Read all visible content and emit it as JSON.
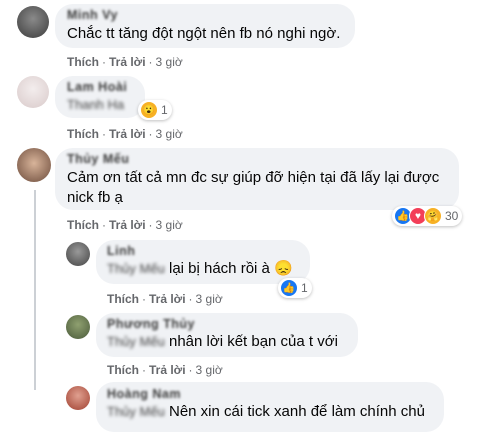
{
  "comments": [
    {
      "name": "Minh Vy",
      "text": "Chắc tt tăng đột ngột nên fb nó nghi ngờ.",
      "actions": {
        "like": "Thích",
        "reply": "Trả lời",
        "time": "3 giờ"
      }
    },
    {
      "name": "Lam Hoài",
      "text_prefix": "Thanh Ha",
      "text": "",
      "reaction": {
        "icons": [
          "wow-icon"
        ],
        "count": "1"
      },
      "actions": {
        "like": "Thích",
        "reply": "Trả lời",
        "time": "3 giờ"
      }
    },
    {
      "name": "Thủy Mếu",
      "text": "Cảm ơn tất cả mn đc sự giúp đỡ hiện tại đã lấy lại được nick fb ạ",
      "reaction": {
        "icons": [
          "like-icon",
          "love-icon",
          "care-icon"
        ],
        "count": "30"
      },
      "actions": {
        "like": "Thích",
        "reply": "Trả lời",
        "time": "3 giờ"
      }
    }
  ],
  "replies": [
    {
      "name": "Linh",
      "text_prefix": "Thủy Mếu",
      "text": "lại bị hách rồi à 😞",
      "reaction": {
        "icons": [
          "like-icon"
        ],
        "count": "1"
      },
      "actions": {
        "like": "Thích",
        "reply": "Trả lời",
        "time": "3 giờ"
      }
    },
    {
      "name": "Phương Thủy",
      "text_prefix": "Thủy Mếu",
      "text": "nhân lời kết bạn của t với",
      "actions": {
        "like": "Thích",
        "reply": "Trả lời",
        "time": "3 giờ"
      }
    },
    {
      "name": "Hoàng Nam",
      "text_prefix": "Thủy Mếu",
      "text": "Nên xin cái tick xanh để làm chính chủ"
    }
  ],
  "colors": {
    "like": "#1877f2",
    "love": "#f33e58",
    "care": "#f7b125",
    "wow": "#f7b125"
  }
}
